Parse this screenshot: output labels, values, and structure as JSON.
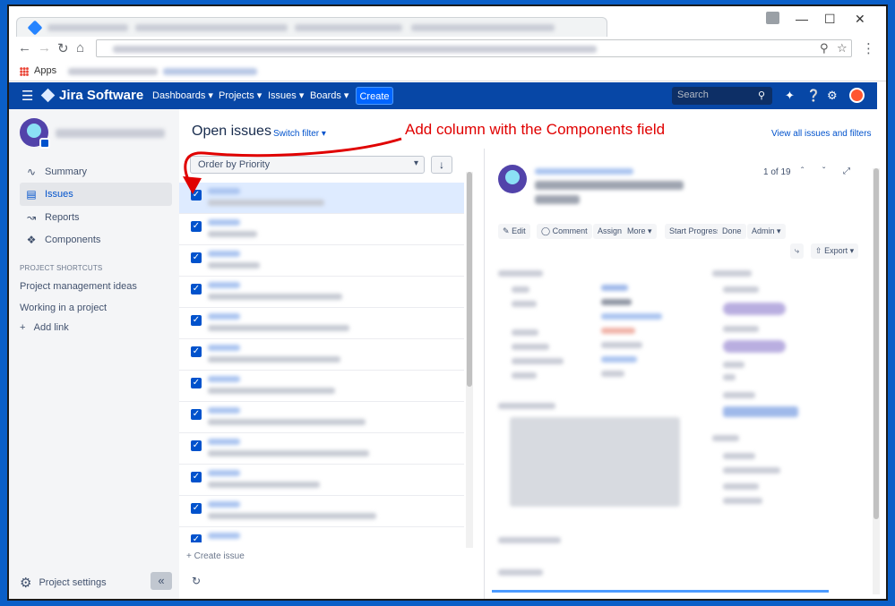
{
  "browser": {
    "bookmarks_apps_label": "Apps"
  },
  "header": {
    "product_name": "Jira Software",
    "nav": [
      "Dashboards",
      "Projects",
      "Issues",
      "Boards"
    ],
    "create_label": "Create",
    "search_placeholder": "Search"
  },
  "sidebar": {
    "items": [
      {
        "label": "Summary",
        "icon": "pulse-icon"
      },
      {
        "label": "Issues",
        "icon": "issues-icon",
        "active": true
      },
      {
        "label": "Reports",
        "icon": "chart-icon"
      },
      {
        "label": "Components",
        "icon": "puzzle-icon"
      }
    ],
    "shortcuts_heading": "PROJECT SHORTCUTS",
    "shortcuts": [
      "Project management ideas",
      "Working in a project"
    ],
    "add_link_label": "Add link",
    "settings_label": "Project settings"
  },
  "list": {
    "title": "Open issues",
    "switch_filter_label": "Switch filter",
    "order_label": "Order by Priority",
    "create_issue_label": "+ Create issue"
  },
  "annotation": {
    "text": "Add column with the Components field"
  },
  "top_right": {
    "view_all_label": "View all issues and filters"
  },
  "detail": {
    "counter": "1 of 19",
    "ops": [
      "Edit",
      "Comment",
      "Assign",
      "More",
      "Start Progress",
      "Done",
      "Admin"
    ],
    "export_label": "Export"
  },
  "colors": {
    "jira_header": "#0747a6",
    "accent": "#0052cc",
    "annotation": "#e00000"
  }
}
